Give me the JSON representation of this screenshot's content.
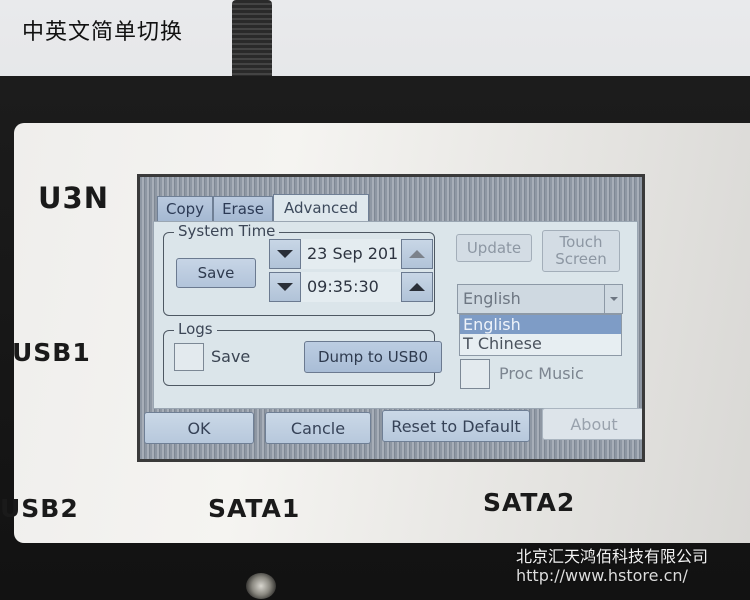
{
  "caption": "中英文简单切换",
  "device": {
    "model_label": "U3N",
    "port_labels": {
      "usb1": "USB1",
      "usb2": "USB2",
      "sata1": "SATA1",
      "sata2": "SATA2"
    }
  },
  "screen": {
    "tabs": [
      {
        "label": "Copy",
        "active": false
      },
      {
        "label": "Erase",
        "active": false
      },
      {
        "label": "Advanced",
        "active": true
      }
    ],
    "system_time": {
      "title": "System Time",
      "save_label": "Save",
      "date_value": "23 Sep 201",
      "time_value": "09:35:30"
    },
    "logs": {
      "title": "Logs",
      "save_checkbox_label": "Save",
      "save_checked": false,
      "dump_label": "Dump to USB0"
    },
    "update_label": "Update",
    "touch_screen_label_line1": "Touch",
    "touch_screen_label_line2": "Screen",
    "language": {
      "selected": "English",
      "options": [
        "English",
        "T Chinese"
      ],
      "highlighted": "English"
    },
    "proc_music": {
      "label": "Proc Music",
      "checked": false
    },
    "footer_buttons": {
      "ok": "OK",
      "cancel": "Cancle",
      "reset": "Reset to Default",
      "about": "About"
    }
  },
  "watermark": {
    "company": "北京汇天鸿佰科技有限公司",
    "url": "http://www.hstore.cn/"
  }
}
